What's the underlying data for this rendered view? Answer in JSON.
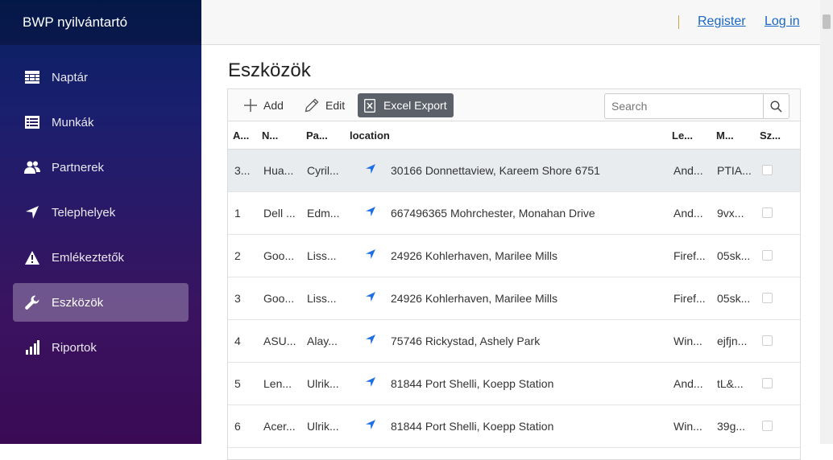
{
  "app": {
    "title": "BWP nyilvántartó"
  },
  "sidebar": {
    "items": [
      {
        "label": "Naptár",
        "icon": "calendar-icon",
        "active": false
      },
      {
        "label": "Munkák",
        "icon": "list-icon",
        "active": false
      },
      {
        "label": "Partnerek",
        "icon": "users-icon",
        "active": false
      },
      {
        "label": "Telephelyek",
        "icon": "location-arrow-icon",
        "active": false
      },
      {
        "label": "Emlékeztetők",
        "icon": "warning-icon",
        "active": false
      },
      {
        "label": "Eszközök",
        "icon": "wrench-icon",
        "active": true
      },
      {
        "label": "Riportok",
        "icon": "bar-chart-icon",
        "active": false
      }
    ]
  },
  "header": {
    "register": "Register",
    "login": "Log in"
  },
  "page": {
    "title": "Eszközök"
  },
  "toolbar": {
    "add_label": "Add",
    "edit_label": "Edit",
    "excel_label": "Excel Export",
    "search_placeholder": "Search"
  },
  "table": {
    "columns": [
      "A...",
      "N...",
      "Pa...",
      "location",
      "Le...",
      "M...",
      "Sz..."
    ],
    "rows": [
      {
        "a": "3...",
        "n": "Hua...",
        "pa": "Cyril...",
        "location": "30166 Donnettaview, Kareem Shore 6751",
        "le": "And...",
        "m": "PTIA...",
        "checked": false,
        "selected": true
      },
      {
        "a": "1",
        "n": "Dell ...",
        "pa": "Edm...",
        "location": "667496365 Mohrchester, Monahan Drive",
        "le": "And...",
        "m": "9vx...",
        "checked": false,
        "selected": false
      },
      {
        "a": "2",
        "n": "Goo...",
        "pa": "Liss...",
        "location": "24926 Kohlerhaven, Marilee Mills",
        "le": "Firef...",
        "m": "05sk...",
        "checked": false,
        "selected": false
      },
      {
        "a": "3",
        "n": "Goo...",
        "pa": "Liss...",
        "location": "24926 Kohlerhaven, Marilee Mills",
        "le": "Firef...",
        "m": "05sk...",
        "checked": false,
        "selected": false
      },
      {
        "a": "4",
        "n": "ASU...",
        "pa": "Alay...",
        "location": "75746 Rickystad, Ashely Park",
        "le": "Win...",
        "m": "ejfjn...",
        "checked": false,
        "selected": false
      },
      {
        "a": "5",
        "n": "Len...",
        "pa": "Ulrik...",
        "location": "81844 Port Shelli, Koepp Station",
        "le": "And...",
        "m": "tL&...",
        "checked": false,
        "selected": false
      },
      {
        "a": "6",
        "n": "Acer...",
        "pa": "Ulrik...",
        "location": "81844 Port Shelli, Koepp Station",
        "le": "Win...",
        "m": "39g...",
        "checked": false,
        "selected": false
      }
    ]
  },
  "colors": {
    "accent": "#1a66c2",
    "location_icon": "#1e6fe6",
    "excel_button": "#5c6169"
  }
}
